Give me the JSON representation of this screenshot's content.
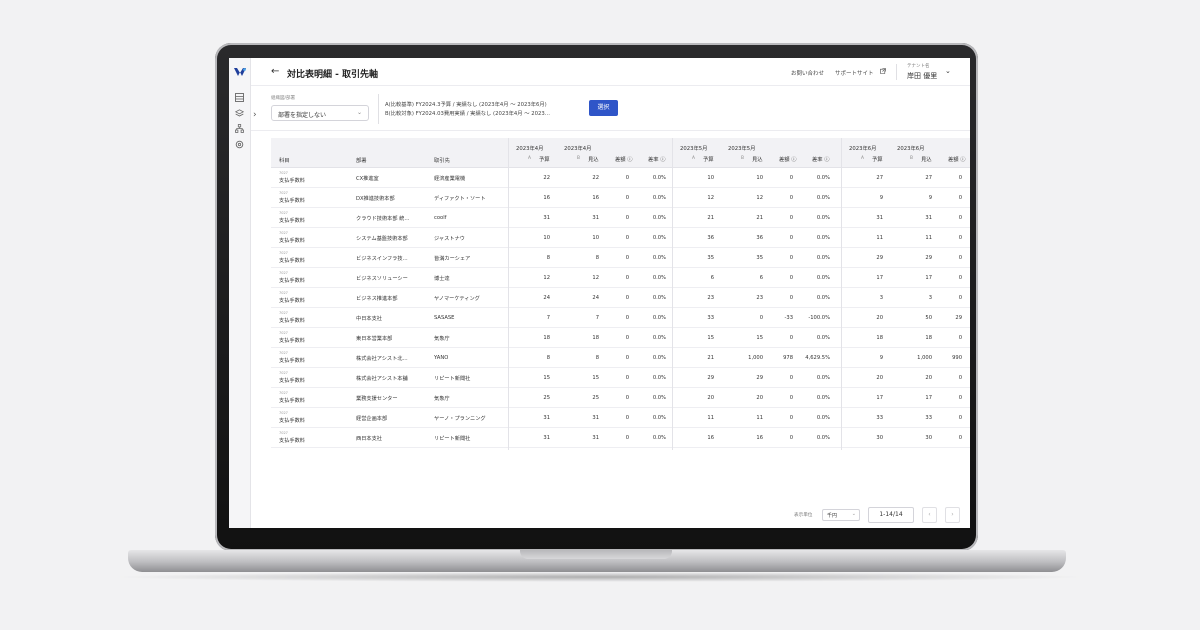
{
  "header": {
    "title": "対比表明細 - 取引先軸",
    "links": [
      "お問い合わせ",
      "サポートサイト"
    ],
    "tenant_label": "テナント名",
    "user_name": "岸田 優里"
  },
  "filters": {
    "dept_label": "組織図/部署",
    "dept_value": "部署を指定しない",
    "compare_a": "A(比較基準) FY2024.3予算 / 実績なし (2023年4月 〜 2023年6月)",
    "compare_b": "B(比較対象) FY2024.03費用実績 / 実績なし (2023年4月 〜 2023…",
    "select_label": "選択"
  },
  "table": {
    "col_account": "科目",
    "col_dept": "部署",
    "col_partner": "取引先",
    "months": [
      "2023年4月",
      "2023年5月",
      "2023年6月"
    ],
    "sub_a": "A",
    "sub_b": "B",
    "budget": "予算",
    "forecast": "見込",
    "diff": "差額",
    "diff_rate": "差率",
    "rows": [
      {
        "code": "7027",
        "account": "支払手数料",
        "dept": "CX推進室",
        "partner": "経済産業電機",
        "m": [
          [
            "22",
            "22",
            "0",
            "0.0%"
          ],
          [
            "10",
            "10",
            "0",
            "0.0%"
          ],
          [
            "27",
            "27",
            "0"
          ]
        ]
      },
      {
        "code": "7027",
        "account": "支払手数料",
        "dept": "DX推進技術本部",
        "partner": "ディファクト・ソート",
        "m": [
          [
            "16",
            "16",
            "0",
            "0.0%"
          ],
          [
            "12",
            "12",
            "0",
            "0.0%"
          ],
          [
            "9",
            "9",
            "0"
          ]
        ]
      },
      {
        "code": "7027",
        "account": "支払手数料",
        "dept": "クラウド技術本部 統…",
        "partner": "coolf",
        "m": [
          [
            "31",
            "31",
            "0",
            "0.0%"
          ],
          [
            "21",
            "21",
            "0",
            "0.0%"
          ],
          [
            "31",
            "31",
            "0"
          ]
        ]
      },
      {
        "code": "7027",
        "account": "支払手数料",
        "dept": "システム基盤技術本部",
        "partner": "ジャストナウ",
        "m": [
          [
            "10",
            "10",
            "0",
            "0.0%"
          ],
          [
            "36",
            "36",
            "0",
            "0.0%"
          ],
          [
            "11",
            "11",
            "0"
          ]
        ]
      },
      {
        "code": "7027",
        "account": "支払手数料",
        "dept": "ビジネスインフラ技…",
        "partner": "皆満カーシェア",
        "m": [
          [
            "8",
            "8",
            "0",
            "0.0%"
          ],
          [
            "35",
            "35",
            "0",
            "0.0%"
          ],
          [
            "29",
            "29",
            "0"
          ]
        ]
      },
      {
        "code": "7027",
        "account": "支払手数料",
        "dept": "ビジネスソリューシー",
        "partner": "博士達",
        "m": [
          [
            "12",
            "12",
            "0",
            "0.0%"
          ],
          [
            "6",
            "6",
            "0",
            "0.0%"
          ],
          [
            "17",
            "17",
            "0"
          ]
        ]
      },
      {
        "code": "7027",
        "account": "支払手数料",
        "dept": "ビジネス推進本部",
        "partner": "ヤノマーケティング",
        "m": [
          [
            "24",
            "24",
            "0",
            "0.0%"
          ],
          [
            "23",
            "23",
            "0",
            "0.0%"
          ],
          [
            "3",
            "3",
            "0"
          ]
        ]
      },
      {
        "code": "7027",
        "account": "支払手数料",
        "dept": "中日本支社",
        "partner": "SASASE",
        "m": [
          [
            "7",
            "7",
            "0",
            "0.0%"
          ],
          [
            "33",
            "0",
            "-33",
            "-100.0%"
          ],
          [
            "20",
            "50",
            "29"
          ]
        ]
      },
      {
        "code": "7027",
        "account": "支払手数料",
        "dept": "東日本営業本部",
        "partner": "気象庁",
        "m": [
          [
            "18",
            "18",
            "0",
            "0.0%"
          ],
          [
            "15",
            "15",
            "0",
            "0.0%"
          ],
          [
            "18",
            "18",
            "0"
          ]
        ]
      },
      {
        "code": "7027",
        "account": "支払手数料",
        "dept": "株式会社アシスト北…",
        "partner": "YANO",
        "m": [
          [
            "8",
            "8",
            "0",
            "0.0%"
          ],
          [
            "21",
            "1,000",
            "978",
            "4,629.5%"
          ],
          [
            "9",
            "1,000",
            "990"
          ]
        ]
      },
      {
        "code": "7027",
        "account": "支払手数料",
        "dept": "株式会社アシスト本舗",
        "partner": "リピート新聞社",
        "m": [
          [
            "15",
            "15",
            "0",
            "0.0%"
          ],
          [
            "29",
            "29",
            "0",
            "0.0%"
          ],
          [
            "20",
            "20",
            "0"
          ]
        ]
      },
      {
        "code": "7027",
        "account": "支払手数料",
        "dept": "業務支援センター",
        "partner": "気象庁",
        "m": [
          [
            "25",
            "25",
            "0",
            "0.0%"
          ],
          [
            "20",
            "20",
            "0",
            "0.0%"
          ],
          [
            "17",
            "17",
            "0"
          ]
        ]
      },
      {
        "code": "7027",
        "account": "支払手数料",
        "dept": "経営企画本部",
        "partner": "ヤーノ・プランニング",
        "m": [
          [
            "31",
            "31",
            "0",
            "0.0%"
          ],
          [
            "11",
            "11",
            "0",
            "0.0%"
          ],
          [
            "33",
            "33",
            "0"
          ]
        ]
      },
      {
        "code": "7027",
        "account": "支払手数料",
        "dept": "西日本支社",
        "partner": "リピート新聞社",
        "m": [
          [
            "31",
            "31",
            "0",
            "0.0%"
          ],
          [
            "16",
            "16",
            "0",
            "0.0%"
          ],
          [
            "30",
            "30",
            "0"
          ]
        ]
      }
    ]
  },
  "footer": {
    "unit_label": "表示単位",
    "unit_value": "千円",
    "page_range": "1-14/14"
  },
  "icons": [
    "logo-icon",
    "table-icon",
    "layers-icon",
    "org-icon",
    "settings-icon",
    "back-arrow-icon",
    "external-link-icon",
    "chevron-down-icon",
    "help-icon"
  ],
  "colors": {
    "primary": "#2f55c8",
    "header_bg": "#f2f2f5"
  }
}
